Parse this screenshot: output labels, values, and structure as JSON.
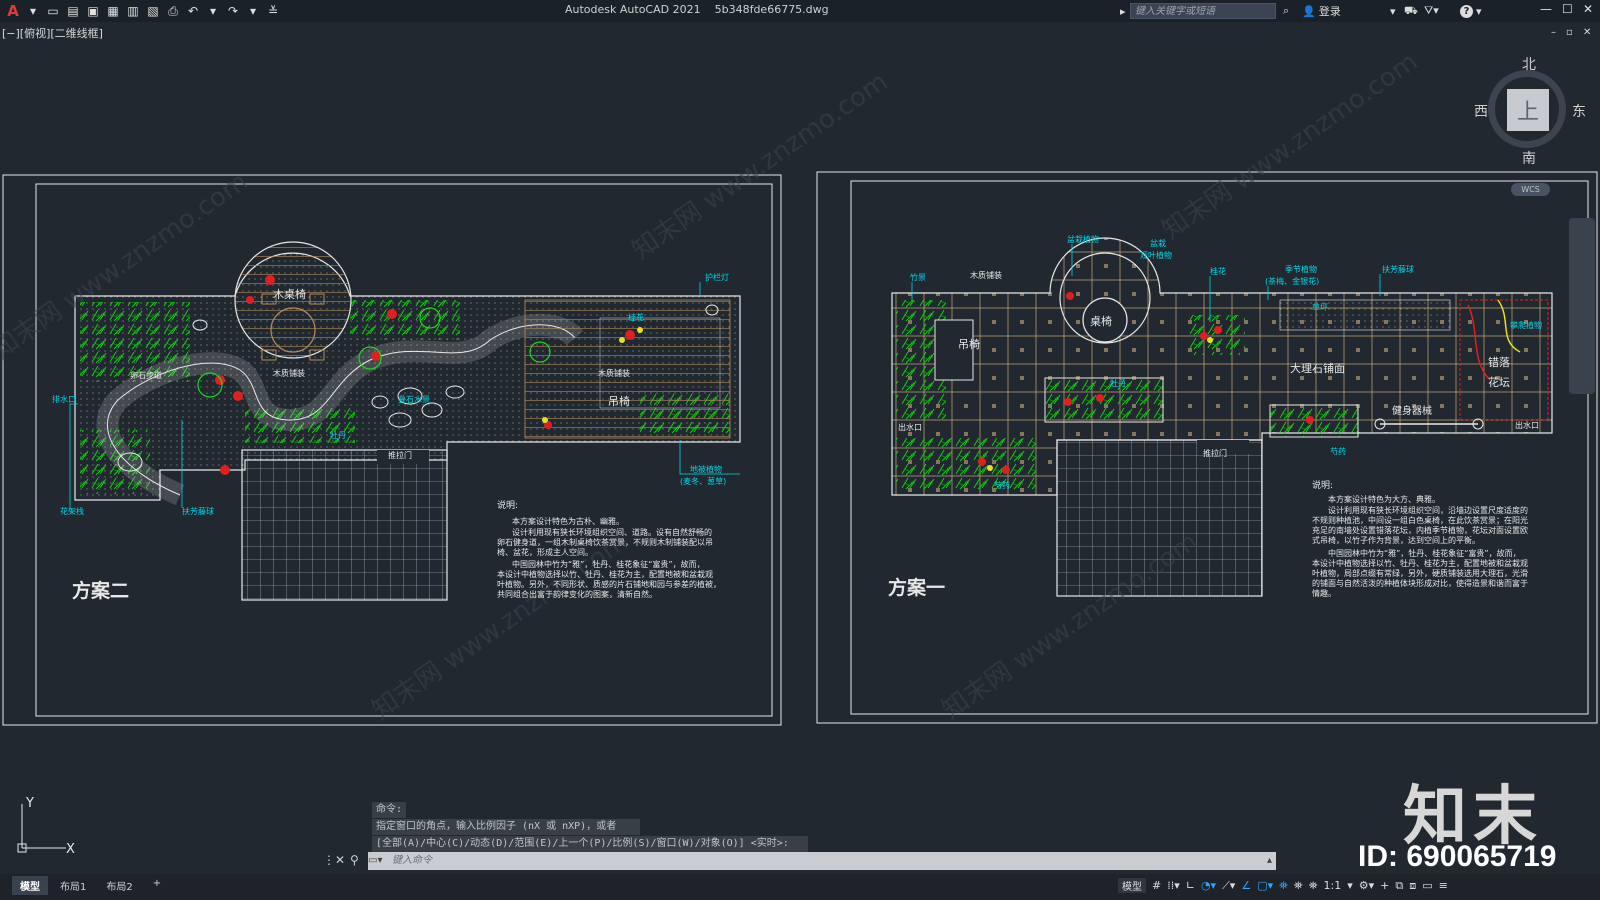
{
  "app": {
    "name": "Autodesk AutoCAD 2021",
    "file": "5b348fde66775.dwg",
    "search_placeholder": "键入关键字或短语",
    "login_label": "登录",
    "help_icon": "?"
  },
  "viewport": {
    "label": "[−][俯视][二维线框]",
    "controls": "– ▫ ×"
  },
  "viewcube": {
    "north": "北",
    "south": "南",
    "east": "东",
    "west": "西",
    "face": "上",
    "wcs": "WCS"
  },
  "ucs": {
    "x": "X",
    "y": "Y"
  },
  "watermark": {
    "logo": "知末",
    "id": "ID: 690065719",
    "diagonal": "知末网 www.znzmo.com"
  },
  "plan_two": {
    "title": "方案二",
    "door": "推拉门",
    "labels": {
      "wood_table": "木桌椅",
      "wood_paving": "木质铺装",
      "pebble_path": "卵石步道",
      "wood_paving_2": "木质铺装",
      "hanging_chair": "吊椅",
      "guard_light": "护栏灯",
      "drain": "排水口",
      "flower_bed": "花架栈",
      "arm_ball": "扶芳藤球",
      "peony": "牡丹",
      "osmanthus": "桂花",
      "waterfall": "叠石水景",
      "groundcover": "地被植物",
      "groundcover_sub": "(麦冬、葱草)"
    },
    "notes_title": "说明:",
    "notes": [
      "本方案设计特色为古朴、幽雅。",
      "设计利用现有狭长环境组织空间、道路。设有自然舒畅的",
      "卵石健身道，一组木制桌椅饮茶赏景，不规则木制铺装配以吊",
      "椅、盆花，形成主人空间。",
      "中国园林中竹为“雅”，牡丹、桂花象征“富贵”，故而，",
      "本设计中植物选择以竹、牡丹、桂花为主，配置地被和盆栽观",
      "叶植物。另外，不同形状、质感的片石铺地和园与参差的植被，",
      "共同组合出富于韵律变化的图案，清新自然。"
    ]
  },
  "plan_one": {
    "title": "方案一",
    "door": "推拉门",
    "labels": {
      "potted": "盆栽植物",
      "potted2": "盆栽",
      "potted2_sub": "观叶植物",
      "bamboo": "竹景",
      "wood_paving": "木质铺装",
      "table": "桌椅",
      "osmanthus": "桂花",
      "seasonal": "季节植物",
      "seasonal_sub": "(茶梅、金银花)",
      "arm_ball": "扶芳藤球",
      "lawn": "草坪",
      "climbing": "攀爬植物",
      "hanging": "吊椅",
      "marble": "大理石铺面",
      "staggered": "错落",
      "flowerbed": "花坛",
      "drain_left": "出水口",
      "drain_right": "出水口",
      "peony": "牡丹",
      "fitness": "健身器械",
      "peony2": "芍药",
      "peony3": "芍药"
    },
    "notes_title": "说明:",
    "notes": [
      "本方案设计特色为大方、典雅。",
      "设计利用现有狭长环境组织空间，沿墙边设置尺度适度的",
      "不规则种植池，中间设一组白色桌椅，在此饮茶赏景；在阳光",
      "充足的南墙处设置错落花坛，内植季节植物，花坛对面设置欧",
      "式吊椅，以竹子作为背景，达到空间上的平衡。",
      "中国园林中竹为“雅”，牡丹、桂花象征“富贵”，故而，",
      "本设计中植物选择以竹、牡丹、桂花为主，配置地被和盆栽观",
      "叶植物，局部点缀有常绿，另外，硬质铺装选用大理石，光滑",
      "的铺面与自然活泼的种植体块形成对比，使得造景和谐而富于",
      "情趣。"
    ]
  },
  "command": {
    "history": [
      "命令:",
      "指定窗口的角点，输入比例因子 (nX 或 nXP)，或者",
      "[全部(A)/中心(C)/动态(D)/范围(E)/上一个(P)/比例(S)/窗口(W)/对象(O)] <实时>:"
    ],
    "placeholder": "键入命令"
  },
  "layout_tabs": [
    "模型",
    "布局1",
    "布局2",
    "+"
  ],
  "status": {
    "model": "模型",
    "scale": "1:1"
  },
  "colors": {
    "background": "#212830",
    "cad_white": "#e8e8e8",
    "cad_cyan": "#00d8e8",
    "cad_green": "#1fd81f",
    "cad_red": "#e02020",
    "cad_yellow": "#e8e020"
  }
}
